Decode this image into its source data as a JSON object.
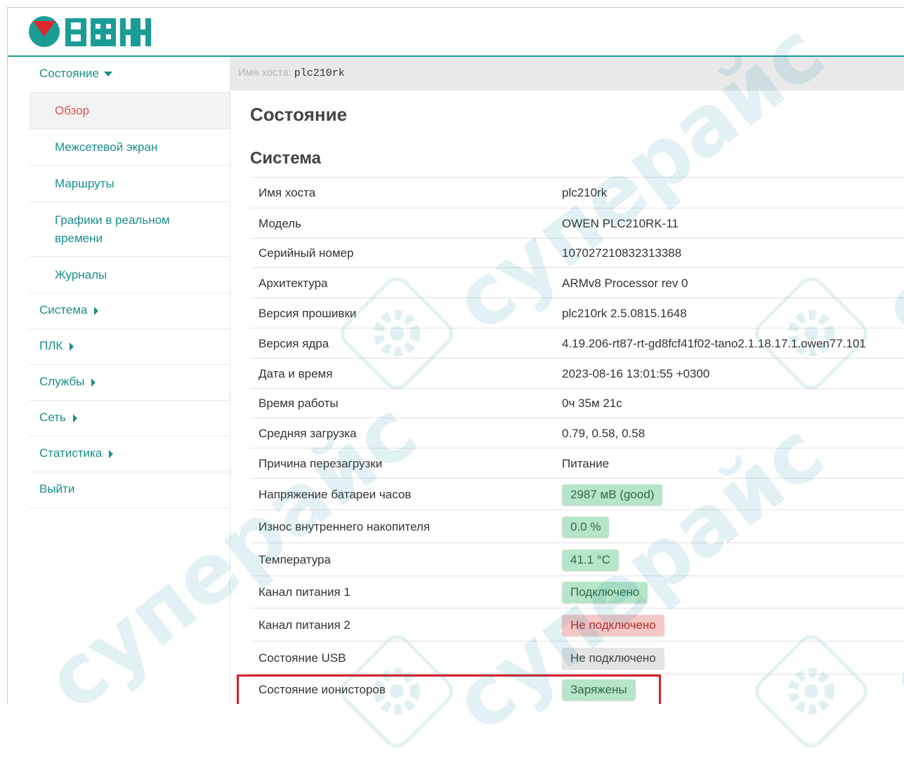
{
  "header": {
    "logo_text": "ОВЕН"
  },
  "sidebar": {
    "status_label": "Состояние",
    "sub_items": [
      {
        "label": "Обзор"
      },
      {
        "label": "Межсетевой экран"
      },
      {
        "label": "Маршруты"
      },
      {
        "label": "Графики в реальном времени"
      },
      {
        "label": "Журналы"
      }
    ],
    "items": [
      {
        "label": "Система"
      },
      {
        "label": "ПЛК"
      },
      {
        "label": "Службы"
      },
      {
        "label": "Сеть"
      },
      {
        "label": "Статистика"
      },
      {
        "label": "Выйти"
      }
    ]
  },
  "hostbar": {
    "label": "Имя хоста:",
    "value": "plc210rk"
  },
  "main": {
    "title": "Состояние",
    "section_title": "Система",
    "rows": [
      {
        "key": "Имя хоста",
        "value": "plc210rk"
      },
      {
        "key": "Модель",
        "value": "OWEN PLC210RK-11"
      },
      {
        "key": "Серийный номер",
        "value": "107027210832313388"
      },
      {
        "key": "Архитектура",
        "value": "ARMv8 Processor rev 0"
      },
      {
        "key": "Версия прошивки",
        "value": "plc210rk 2.5.0815.1648"
      },
      {
        "key": "Версия ядра",
        "value": "4.19.206-rt87-rt-gd8fcf41f02-tano2.1.18.17.1.owen77.101"
      },
      {
        "key": "Дата и время",
        "value": "2023-08-16 13:01:55 +0300"
      },
      {
        "key": "Время работы",
        "value": "0ч 35м 21с"
      },
      {
        "key": "Средняя загрузка",
        "value": "0.79, 0.58, 0.58"
      },
      {
        "key": "Причина перезагрузки",
        "value": "Питание"
      },
      {
        "key": "Напряжение батареи часов",
        "value": "2987 мВ (good)",
        "status": "green"
      },
      {
        "key": "Износ внутреннего накопителя",
        "value": "0.0 %",
        "status": "green"
      },
      {
        "key": "Температура",
        "value": "41.1 °C",
        "status": "green"
      },
      {
        "key": "Канал питания 1",
        "value": "Подключено",
        "status": "green"
      },
      {
        "key": "Канал питания 2",
        "value": "Не подключено",
        "status": "red"
      },
      {
        "key": "Состояние USB",
        "value": "Не подключено",
        "status": "gray"
      },
      {
        "key": "Состояние ионисторов",
        "value": "Заряжены",
        "status": "green"
      }
    ]
  },
  "colors": {
    "accent": "#1a9c97",
    "logo_red": "#e0282c",
    "logo_teal": "#1a9c97",
    "active_nav": "#e05050",
    "highlight_border": "#d42027"
  },
  "watermark": {
    "text": "суперайс"
  }
}
